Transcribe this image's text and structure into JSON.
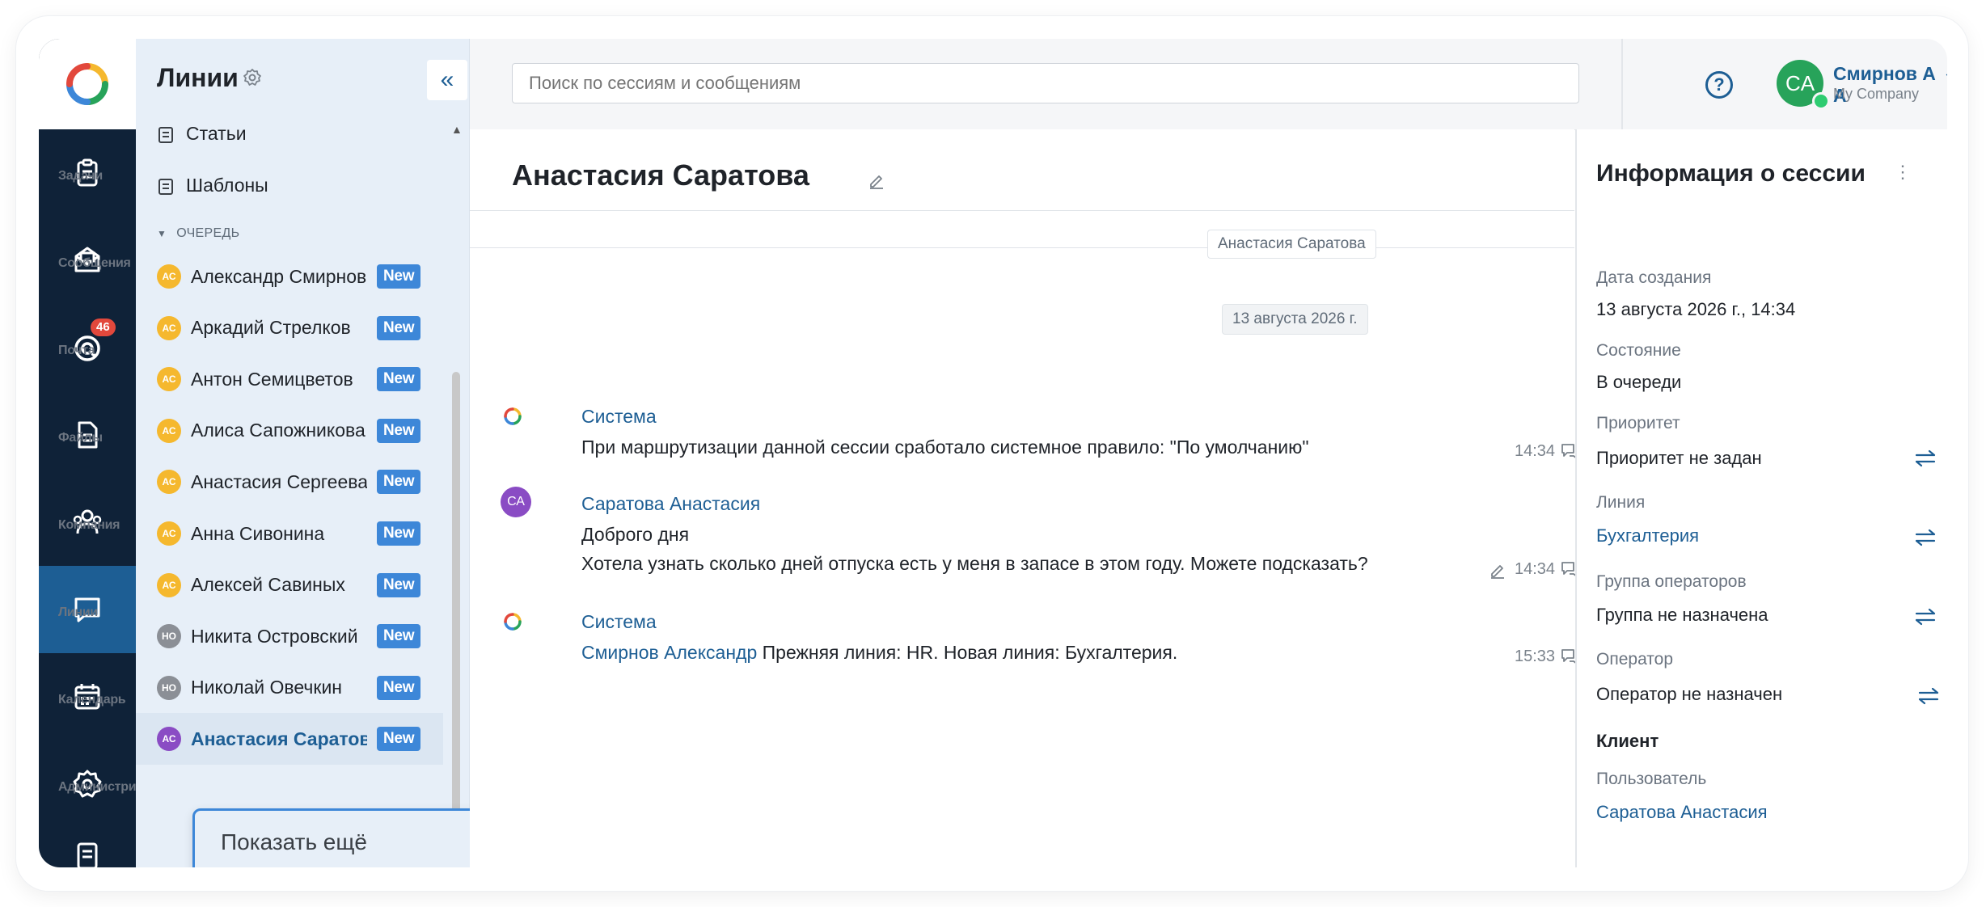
{
  "rail": {
    "items": [
      {
        "label": "Задачи",
        "icon": "tasks-icon"
      },
      {
        "label": "Сообщения",
        "icon": "messages-icon"
      },
      {
        "label": "Почта",
        "icon": "mail-icon",
        "badge": "46"
      },
      {
        "label": "Файлы",
        "icon": "files-icon"
      },
      {
        "label": "Компания",
        "icon": "company-icon"
      },
      {
        "label": "Линии",
        "icon": "lines-icon",
        "active": true
      },
      {
        "label": "Календарь",
        "icon": "calendar-icon"
      },
      {
        "label": "Администри...",
        "icon": "admin-gear-icon"
      },
      {
        "label": "",
        "icon": "document-icon"
      }
    ]
  },
  "lines_panel": {
    "title": "Линии",
    "links": [
      "Статьи",
      "Шаблоны"
    ],
    "queue_label": "ОЧЕРЕДЬ",
    "queue": [
      {
        "initials": "АС",
        "name": "Александр Смирнов",
        "badge": "New",
        "color": "#f5b82e"
      },
      {
        "initials": "АС",
        "name": "Аркадий Стрелков",
        "badge": "New",
        "color": "#f5b82e"
      },
      {
        "initials": "АС",
        "name": "Антон Семицветов",
        "badge": "New",
        "color": "#f5b82e"
      },
      {
        "initials": "АС",
        "name": "Алиса Сапожникова",
        "badge": "New",
        "color": "#f5b82e"
      },
      {
        "initials": "АС",
        "name": "Анастасия Сергеева",
        "badge": "New",
        "color": "#f5b82e"
      },
      {
        "initials": "АС",
        "name": "Анна Сивонина",
        "badge": "New",
        "color": "#f5b82e"
      },
      {
        "initials": "АС",
        "name": "Алексей Савиных",
        "badge": "New",
        "color": "#f5b82e"
      },
      {
        "initials": "НО",
        "name": "Никита Островский",
        "badge": "New",
        "color": "#8b8f96"
      },
      {
        "initials": "НО",
        "name": "Николай Овечкин",
        "badge": "New",
        "color": "#8b8f96"
      },
      {
        "initials": "АС",
        "name": "Анастасия Саратова",
        "badge": "New",
        "color": "#8a4cc4",
        "selected": true
      }
    ],
    "show_more": "Показать ещё"
  },
  "topbar": {
    "search_placeholder": "Поиск по сессиям и сообщениям",
    "help": "?",
    "user": {
      "initials": "CA",
      "name": "Смирнов А А",
      "company": "My Company"
    }
  },
  "chat": {
    "title": "Анастасия Саратова",
    "name_chip": "Анастасия Саратова",
    "date_chip": "13 августа 2026 г.",
    "messages": [
      {
        "author": "Система",
        "lines": [
          "При маршрутизации данной сессии сработало системное правило: \"По умолчанию\""
        ],
        "time": "14:34"
      },
      {
        "author": "Саратова Анастасия",
        "initials": "СА",
        "lines": [
          "Доброго дня",
          "Хотела узнать сколько дней отпуска есть у меня в запасе в этом году. Можете подсказать?"
        ],
        "time": "14:34"
      },
      {
        "author": "Система",
        "link": "Смирнов Александр",
        "text": " Прежняя линия: HR. Новая линия: Бухгалтерия.",
        "time": "15:33"
      }
    ]
  },
  "info": {
    "title": "Информация о сессии",
    "created_label": "Дата создания",
    "created_value": "13 августа 2026 г., 14:34",
    "state_label": "Состояние",
    "state_value": "В очереди",
    "priority_label": "Приоритет",
    "priority_value": "Приоритет не задан",
    "line_label": "Линия",
    "line_value": "Бухгалтерия",
    "group_label": "Группа операторов",
    "group_value": "Группа не назначена",
    "operator_label": "Оператор",
    "operator_value": "Оператор не назначен",
    "client_heading": "Клиент",
    "user_label": "Пользователь",
    "user_value": "Саратова Анастасия"
  }
}
